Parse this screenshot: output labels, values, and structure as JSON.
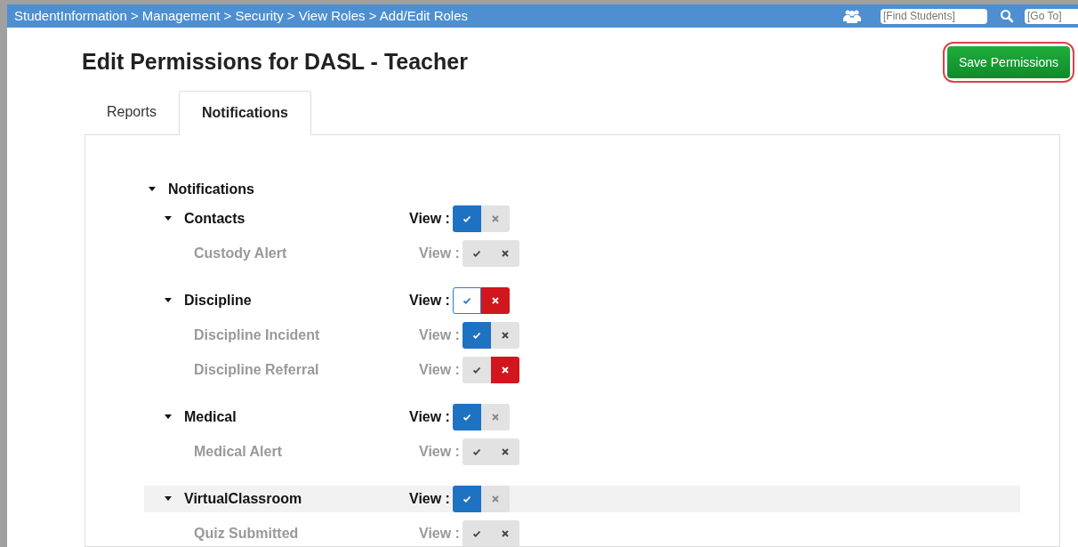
{
  "top_bar": {
    "breadcrumb": "StudentInformation > Management > Security > View Roles > Add/Edit Roles",
    "find_students": {
      "placeholder": "[Find Students]"
    },
    "go_to": {
      "placeholder": "[Go To]"
    }
  },
  "title": "Edit Permissions for DASL - Teacher",
  "save_button": "Save Permissions",
  "tabs": [
    {
      "label": "Reports",
      "selected": false
    },
    {
      "label": "Notifications",
      "selected": true
    }
  ],
  "tree": {
    "label": "Notifications",
    "expanded": true,
    "children": [
      {
        "label": "Contacts",
        "expanded": true,
        "highlighted": false,
        "view_label": "View :",
        "options": [
          {
            "kind": "allow",
            "selected": true,
            "partial": false
          },
          {
            "kind": "deny",
            "selected": false
          }
        ],
        "children": [
          {
            "label": "Custody Alert",
            "view_label": "View :",
            "options": [
              {
                "kind": "allow",
                "selected": false
              },
              {
                "kind": "deny",
                "selected": false
              }
            ]
          }
        ]
      },
      {
        "label": "Discipline",
        "expanded": true,
        "highlighted": false,
        "view_label": "View :",
        "options": [
          {
            "kind": "allow",
            "selected": false,
            "partial": true
          },
          {
            "kind": "deny",
            "selected": true
          }
        ],
        "children": [
          {
            "label": "Discipline Incident",
            "view_label": "View :",
            "options": [
              {
                "kind": "allow",
                "selected": true
              },
              {
                "kind": "deny",
                "selected": false
              }
            ]
          },
          {
            "label": "Discipline Referral",
            "view_label": "View :",
            "options": [
              {
                "kind": "allow",
                "selected": false
              },
              {
                "kind": "deny",
                "selected": true
              }
            ]
          }
        ]
      },
      {
        "label": "Medical",
        "expanded": true,
        "highlighted": false,
        "view_label": "View :",
        "options": [
          {
            "kind": "allow",
            "selected": true,
            "partial": false
          },
          {
            "kind": "deny",
            "selected": false
          }
        ],
        "children": [
          {
            "label": "Medical Alert",
            "view_label": "View :",
            "options": [
              {
                "kind": "allow",
                "selected": false
              },
              {
                "kind": "deny",
                "selected": false
              }
            ]
          }
        ]
      },
      {
        "label": "VirtualClassroom",
        "expanded": true,
        "highlighted": true,
        "view_label": "View :",
        "options": [
          {
            "kind": "allow",
            "selected": true,
            "partial": false
          },
          {
            "kind": "deny",
            "selected": false
          }
        ],
        "children": [
          {
            "label": "Quiz Submitted",
            "view_label": "View :",
            "options": [
              {
                "kind": "allow",
                "selected": false
              },
              {
                "kind": "deny",
                "selected": false
              }
            ]
          }
        ]
      }
    ]
  }
}
